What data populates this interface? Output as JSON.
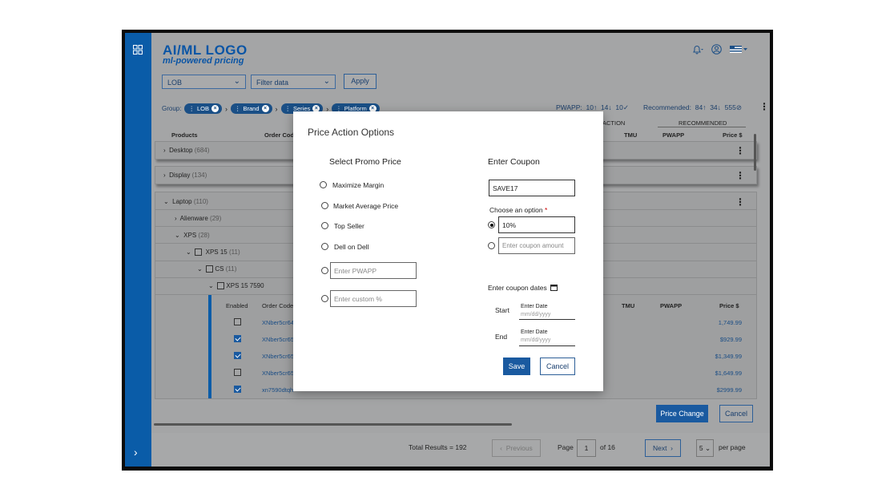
{
  "header": {
    "logo_title": "AI/ML LOGO",
    "logo_subtitle": "ml-powered pricing",
    "icons": [
      "bell-icon",
      "user-icon",
      "flag-icon"
    ]
  },
  "filters": {
    "lob_select": "LOB",
    "filter_select": "Filter data",
    "apply_label": "Apply"
  },
  "group": {
    "label": "Group:",
    "chips": [
      "LOB",
      "Brand",
      "Series",
      "Platform"
    ]
  },
  "summary": {
    "pwapp_label": "PWAPP:",
    "pwapp_values": [
      "10↑",
      "14↓",
      "10✓"
    ],
    "recommended_label": "Recommended:",
    "recommended_values": [
      "84↑",
      "34↓",
      "555⊘"
    ]
  },
  "table": {
    "headers": {
      "products": "Products",
      "order_code": "Order Code",
      "action_partial": "ACTION",
      "tmu": "TMU",
      "recommended": "RECOMMENDED",
      "pwapp": "PWAPP",
      "price": "Price $"
    },
    "groups": [
      {
        "name": "Desktop",
        "count": "(684)"
      },
      {
        "name": "Display",
        "count": "(134)"
      },
      {
        "name": "Laptop",
        "count": "(110)"
      }
    ],
    "tree": [
      {
        "name": "Alienware",
        "count": "(29)"
      },
      {
        "name": "XPS",
        "count": "(28)"
      },
      {
        "name": "XPS 15",
        "count": "(11)"
      },
      {
        "name": "CS",
        "count": "(11)"
      },
      {
        "name": "XPS 15 7590",
        "count": ""
      }
    ],
    "sub_headers": {
      "enabled": "Enabled",
      "order_code": "Order Code",
      "tmu": "TMU",
      "pwapp": "PWAPP",
      "price": "Price $"
    },
    "rows": [
      {
        "enabled": false,
        "order_code": "XNber5cr64",
        "price": "1,749.99"
      },
      {
        "enabled": true,
        "order_code": "XNber5cr65",
        "price": "$929.99"
      },
      {
        "enabled": true,
        "order_code": "XNber5cr65",
        "price": "$1,349.99"
      },
      {
        "enabled": false,
        "order_code": "XNber5cr65",
        "price": "$1,649.99"
      },
      {
        "enabled": true,
        "order_code": "xn7590dtqh",
        "price": "$2999.99"
      }
    ]
  },
  "actions": {
    "price_change": "Price Change",
    "cancel": "Cancel"
  },
  "footer": {
    "total_results": "Total Results = 192",
    "previous": "Previous",
    "page_label": "Page",
    "page_value": "1",
    "of_pages": "of 16",
    "next": "Next",
    "per_page_value": "5",
    "per_page_label": "per page"
  },
  "modal": {
    "title": "Price Action Options",
    "promo_title": "Select Promo Price",
    "promo_options": [
      "Maximize Margin",
      "Market Average Price",
      "Top Seller",
      "Dell on Dell"
    ],
    "pwapp_placeholder": "Enter PWAPP",
    "custom_placeholder": "Enter custom %",
    "coupon_title": "Enter Coupon",
    "coupon_value": "SAVE17",
    "choose_label": "Choose an option",
    "required_mark": "*",
    "option_percent": "10%",
    "amount_placeholder": "Enter coupon amount",
    "dates_label": "Enter coupon dates",
    "start_label": "Start",
    "end_label": "End",
    "date_caption": "Enter Date",
    "date_placeholder": "mm/dd/yyyy",
    "save": "Save",
    "cancel": "Cancel"
  }
}
